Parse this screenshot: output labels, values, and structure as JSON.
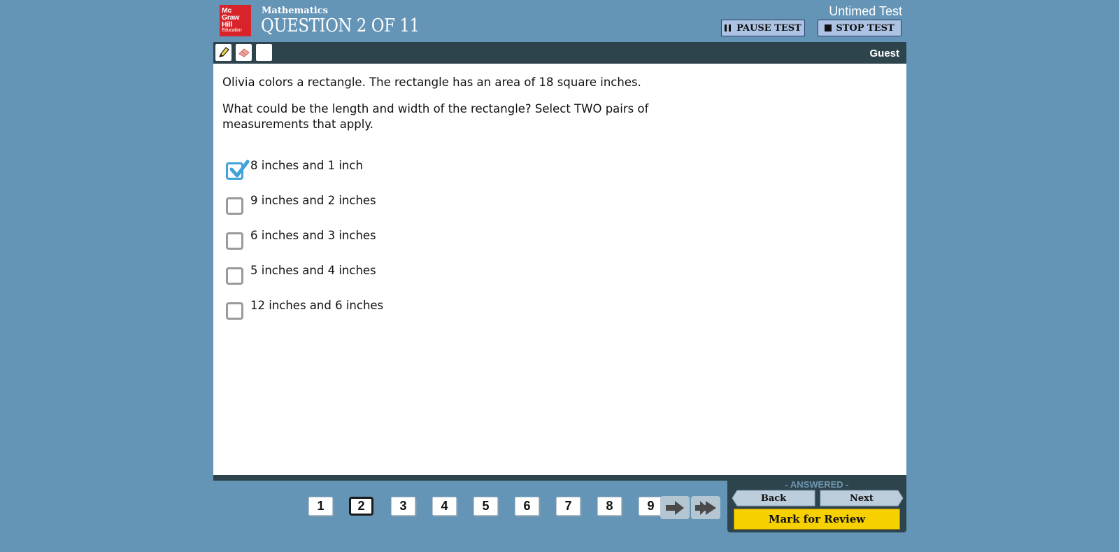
{
  "header": {
    "logo_lines": [
      "Mc",
      "Graw",
      "Hill",
      "Education"
    ],
    "subject": "Mathematics",
    "question_title": "QUESTION 2 OF 11",
    "timer_label": "Untimed Test",
    "pause_label": "PAUSE TEST",
    "stop_label": "STOP TEST"
  },
  "toolbar": {
    "tools": [
      "highlighter-icon",
      "eraser-icon",
      "blank-tool"
    ],
    "user": "Guest"
  },
  "question": {
    "stem": "Olivia colors a rectangle. The rectangle has an area of 18 square inches.",
    "prompt": "What could be the length and width of the rectangle? Select TWO pairs of measurements that apply.",
    "choices": [
      {
        "label": "8 inches and 1 inch",
        "checked": true
      },
      {
        "label": "9 inches and 2 inches",
        "checked": false
      },
      {
        "label": "6 inches and 3 inches",
        "checked": false
      },
      {
        "label": "5 inches and 4 inches",
        "checked": false
      },
      {
        "label": "12 inches and 6 inches",
        "checked": false
      }
    ]
  },
  "navigation": {
    "numbers": [
      "1",
      "2",
      "3",
      "4",
      "5",
      "6",
      "7",
      "8",
      "9"
    ],
    "current": "2",
    "status": "- ANSWERED -",
    "back_label": "Back",
    "next_label": "Next",
    "review_label": "Mark for Review"
  },
  "colors": {
    "background": "#6494b6",
    "toolbar": "#2e444c",
    "checked": "#3fa3d9",
    "review": "#f7d000",
    "logo": "#d8232a"
  }
}
